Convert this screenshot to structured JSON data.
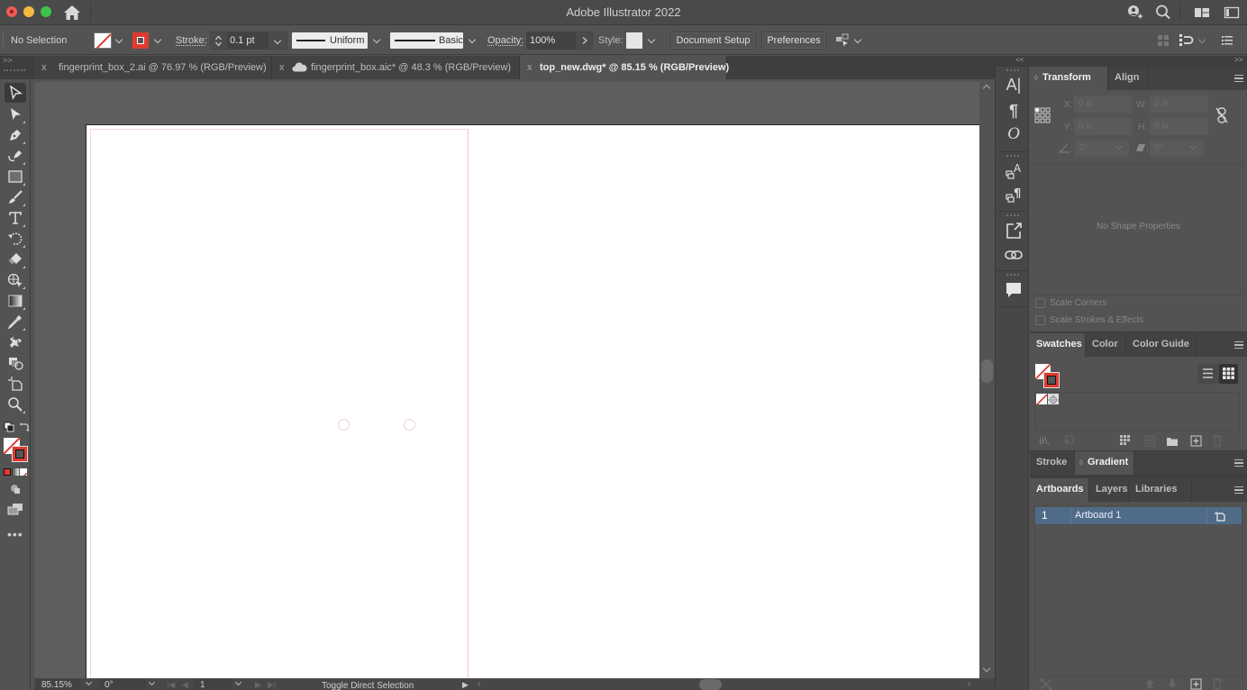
{
  "window": {
    "title": "Adobe Illustrator 2022",
    "traffic_lights": [
      "close",
      "minimize",
      "maximize"
    ]
  },
  "colors": {
    "accent_red": "#e03a30",
    "artboard_selected_row": "#4f6b87",
    "panel_bg": "#535353",
    "canvas_bg": "#5e5e5e"
  },
  "control_bar": {
    "selection_status": "No Selection",
    "stroke_label": "Stroke:",
    "stroke_weight": "0.1 pt",
    "stroke_profile": "Uniform",
    "brush_definition": "Basic",
    "opacity_label": "Opacity:",
    "opacity_value": "100%",
    "style_label": "Style:",
    "document_setup_button": "Document Setup",
    "preferences_button": "Preferences"
  },
  "tabs": [
    {
      "close": "x",
      "label": "fingerprint_box_2.ai @ 76.97 % (RGB/Preview)",
      "cloud": false,
      "active": false
    },
    {
      "close": "x",
      "label": "fingerprint_box.aic* @ 48.3 % (RGB/Preview)",
      "cloud": true,
      "active": false
    },
    {
      "close": "x",
      "label": "top_new.dwg* @ 85.15 % (RGB/Preview)",
      "cloud": false,
      "active": true
    }
  ],
  "tools": [
    "selection-tool",
    "direct-selection-tool",
    "pen-tool",
    "curvature-tool",
    "rectangle-tool",
    "paintbrush-tool",
    "type-tool",
    "rotate-tool",
    "eraser-tool",
    "shape-builder-tool",
    "gradient-tool",
    "eyedropper-tool",
    "puppet-warp-tool",
    "live-paint-tool",
    "artboard-tool",
    "zoom-tool"
  ],
  "panel_collapse": {
    "left": "<<",
    "right": ">>",
    "tools": ">>"
  },
  "transform_panel": {
    "tabs": [
      "Transform",
      "Align"
    ],
    "active_tab": "Transform",
    "x_label": "X:",
    "x_value": "0 in",
    "y_label": "Y:",
    "y_value": "0 in",
    "w_label": "W:",
    "w_value": "0 in",
    "h_label": "H:",
    "h_value": "0 in",
    "angle_label": ":",
    "angle_value": "0°",
    "shear_label": ":",
    "shear_value": "0°",
    "no_shape": "No Shape Properties",
    "scale_corners": "Scale Corners",
    "scale_strokes": "Scale Strokes & Effects"
  },
  "swatches_panel": {
    "tabs": [
      "Swatches",
      "Color",
      "Color Guide"
    ],
    "active_tab": "Swatches"
  },
  "stroke_gradient_panel": {
    "tabs": [
      "Stroke",
      "Gradient"
    ],
    "active_tab": "Gradient"
  },
  "artboards_panel": {
    "tabs": [
      "Artboards",
      "Layers",
      "Libraries"
    ],
    "active_tab": "Artboards",
    "rows": [
      {
        "number": "1",
        "name": "Artboard 1",
        "selected": true
      }
    ]
  },
  "status_bar": {
    "zoom": "85.15%",
    "rotation": "0°",
    "artboard_number": "1",
    "current_tool_hint": "Toggle Direct Selection"
  }
}
